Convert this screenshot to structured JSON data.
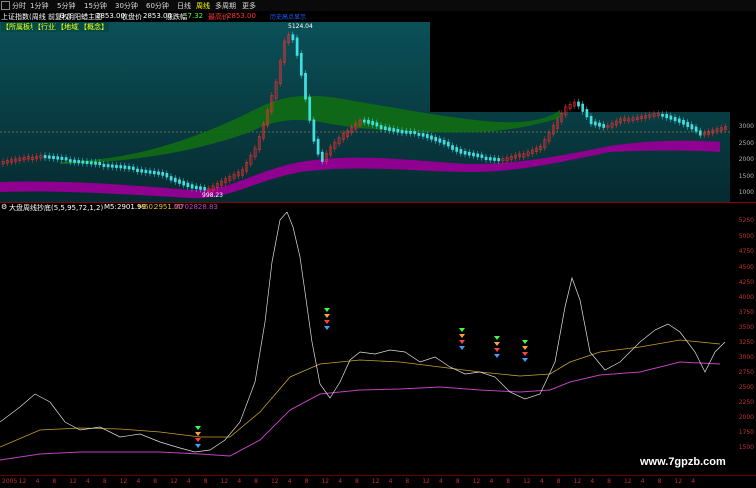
{
  "toolbar": {
    "items": [
      {
        "label": "分时",
        "active": false
      },
      {
        "label": "1分钟",
        "active": false
      },
      {
        "label": "5分钟",
        "active": false
      },
      {
        "label": "15分钟",
        "active": false
      },
      {
        "label": "30分钟",
        "active": false
      },
      {
        "label": "60分钟",
        "active": false
      },
      {
        "label": "日线",
        "active": false
      },
      {
        "label": "周线",
        "active": true
      },
      {
        "label": "多周期",
        "active": false
      },
      {
        "label": "更多",
        "active": false
      }
    ]
  },
  "info_bar": {
    "symbol": "上证指数(周线 前复权)",
    "pattern": "阴阳蜡主图",
    "pattern_value": "2853.00",
    "close_label": "收盘价",
    "close_value": "2853.00",
    "change_label": "涨跌幅",
    "change_value": "-7.32",
    "high_label": "最高价",
    "high_value": "2853.00"
  },
  "tags": [
    "【所属板块】",
    "【行业】",
    "【地域】",
    "【概念】"
  ],
  "main_chart": {
    "peak_label": "5124.04",
    "peak_box_label": "历史高点显示",
    "low_label": "998.23",
    "ref_line": 2853,
    "axis_labels": [
      "3000",
      "2500",
      "2000",
      "1500",
      "1000"
    ]
  },
  "indicator": {
    "title": "大盘周线抄底(5,5,95,72,1,2)",
    "ma5_label": "M5:",
    "ma5_value": "2901.99",
    "ma60_label": "M60:",
    "ma60_value": "2951.00",
    "ma70_label": "M70:",
    "ma70_value": "2828.83",
    "axis_labels": [
      "5250",
      "5000",
      "4750",
      "4500",
      "4250",
      "4000",
      "3750",
      "3500",
      "3250",
      "3000",
      "2750",
      "2500",
      "2250",
      "2000",
      "1750",
      "1500"
    ]
  },
  "date_axis": {
    "labels": [
      "2005",
      "12",
      "4",
      "8",
      "12",
      "4",
      "8",
      "12",
      "4",
      "8",
      "12",
      "4",
      "8",
      "12",
      "4",
      "8",
      "12",
      "4",
      "8",
      "12",
      "4",
      "8",
      "12",
      "4",
      "8",
      "12",
      "4",
      "8",
      "12",
      "4",
      "8",
      "12",
      "4",
      "8",
      "12",
      "4",
      "8",
      "12",
      "4",
      "8",
      "12",
      "4"
    ]
  },
  "watermark": "www.7gpzb.com",
  "colors": {
    "ma_yellow": "#c8a030",
    "ma_purple": "#c040c0",
    "price_line": "#e0e0e0",
    "bull": "#ff3030",
    "bear": "#40e0e0",
    "green_band": "#107010",
    "purple_band": "#900090",
    "teal_bg": "#0b4a50"
  }
}
